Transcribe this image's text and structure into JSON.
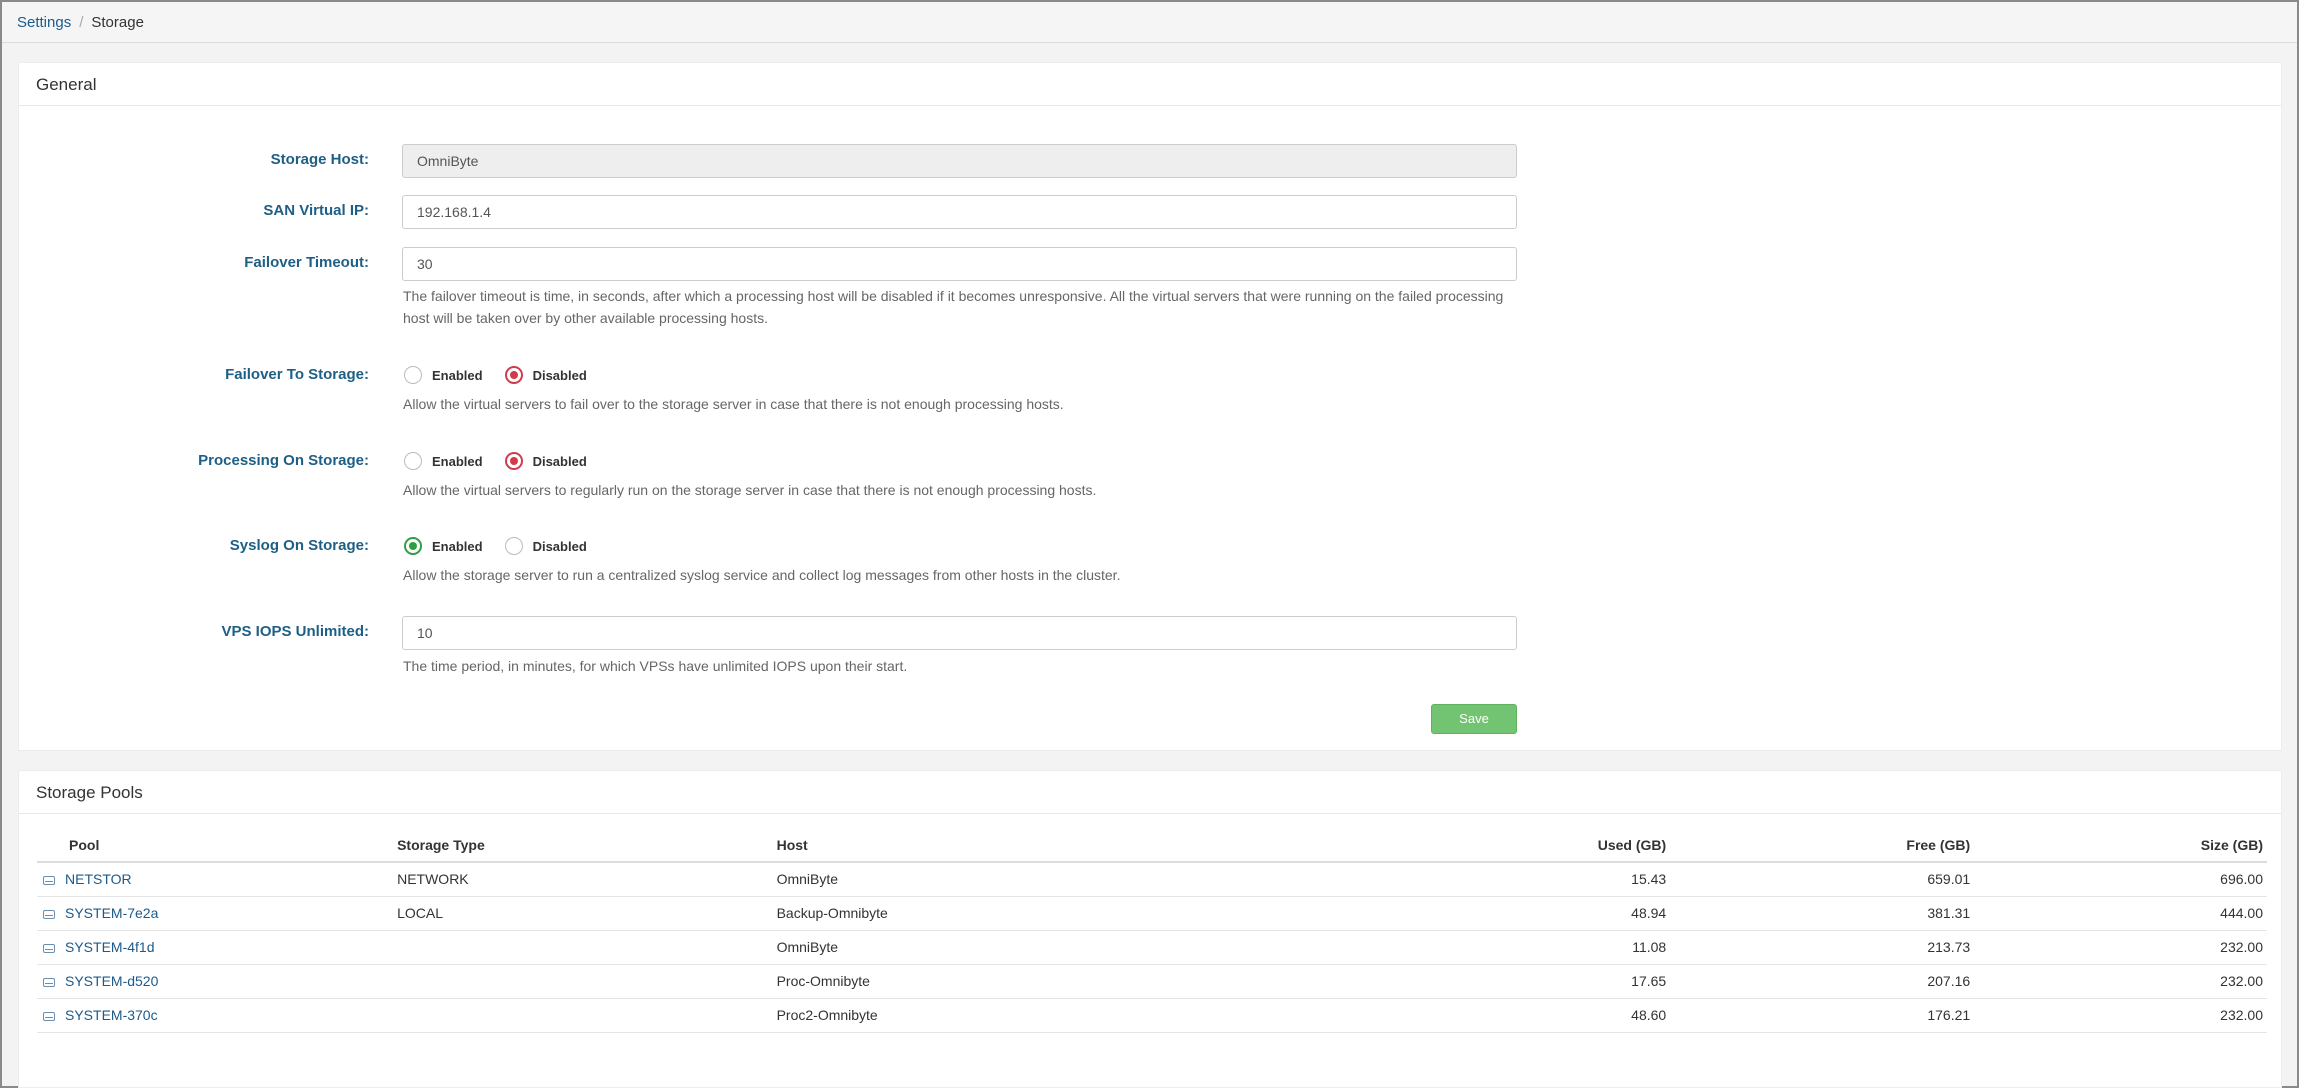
{
  "breadcrumb": {
    "parent": "Settings",
    "separator": "/",
    "current": "Storage"
  },
  "general": {
    "title": "General",
    "storage_host": {
      "label": "Storage Host:",
      "value": "OmniByte"
    },
    "san_virtual_ip": {
      "label": "SAN Virtual IP:",
      "value": "192.168.1.4"
    },
    "failover_timeout": {
      "label": "Failover Timeout:",
      "value": "30",
      "help_line1": "The failover timeout is time, in seconds, after which a processing host will be disabled if it becomes unresponsive. All the virtual servers that were running on the failed processing",
      "help_line2": "host will be taken over by other available processing hosts."
    },
    "failover_to_storage": {
      "label": "Failover To Storage:",
      "enabled_label": "Enabled",
      "disabled_label": "Disabled",
      "selected": "Disabled",
      "help": "Allow the virtual servers to fail over to the storage server in case that there is not enough processing hosts."
    },
    "processing_on_storage": {
      "label": "Processing On Storage:",
      "enabled_label": "Enabled",
      "disabled_label": "Disabled",
      "selected": "Disabled",
      "help": "Allow the virtual servers to regularly run on the storage server in case that there is not enough processing hosts."
    },
    "syslog_on_storage": {
      "label": "Syslog On Storage:",
      "enabled_label": "Enabled",
      "disabled_label": "Disabled",
      "selected": "Enabled",
      "help": "Allow the storage server to run a centralized syslog service and collect log messages from other hosts in the cluster."
    },
    "vps_iops_unlimited": {
      "label": "VPS IOPS Unlimited:",
      "value": "10",
      "help": "The time period, in minutes, for which VPSs have unlimited IOPS upon their start."
    },
    "save_label": "Save"
  },
  "pools": {
    "title": "Storage Pools",
    "columns": {
      "pool": "Pool",
      "storage_type": "Storage Type",
      "host": "Host",
      "used": "Used (GB)",
      "free": "Free (GB)",
      "size": "Size (GB)"
    },
    "rows": [
      {
        "pool": "NETSTOR",
        "storage_type": "NETWORK",
        "host": "OmniByte",
        "used": "15.43",
        "free": "659.01",
        "size": "696.00"
      },
      {
        "pool": "SYSTEM-7e2a",
        "storage_type": "LOCAL",
        "host": "Backup-Omnibyte",
        "used": "48.94",
        "free": "381.31",
        "size": "444.00"
      },
      {
        "pool": "SYSTEM-4f1d",
        "storage_type": "",
        "host": "OmniByte",
        "used": "11.08",
        "free": "213.73",
        "size": "232.00"
      },
      {
        "pool": "SYSTEM-d520",
        "storage_type": "",
        "host": "Proc-Omnibyte",
        "used": "17.65",
        "free": "207.16",
        "size": "232.00"
      },
      {
        "pool": "SYSTEM-370c",
        "storage_type": "",
        "host": "Proc2-Omnibyte",
        "used": "48.60",
        "free": "176.21",
        "size": "232.00"
      }
    ]
  }
}
